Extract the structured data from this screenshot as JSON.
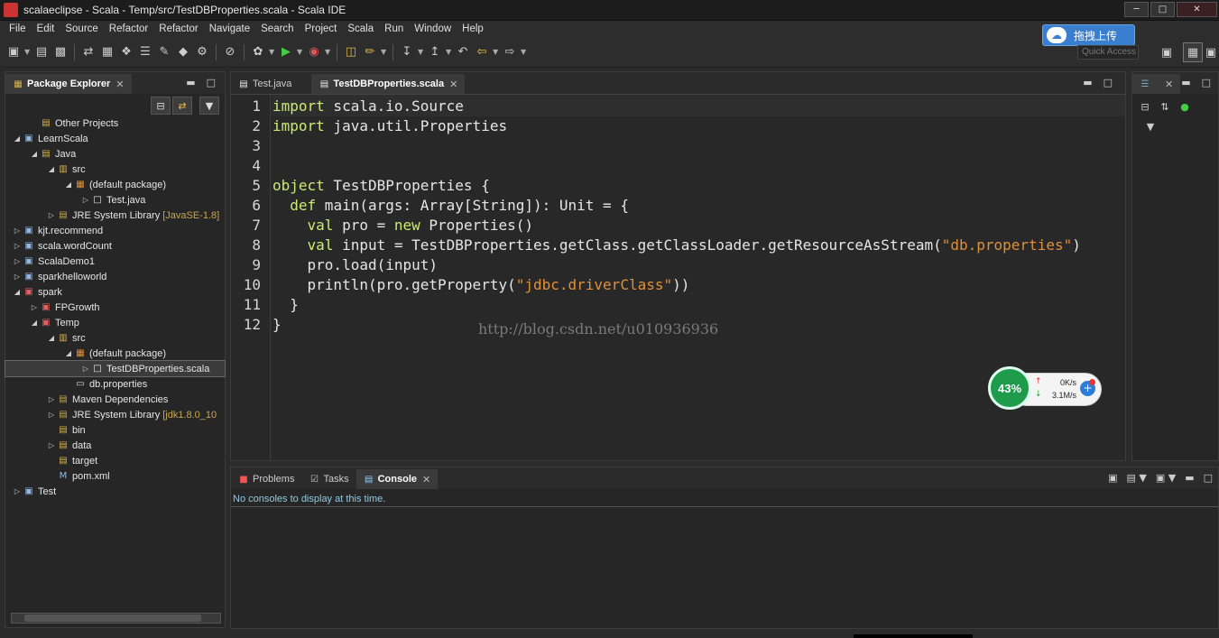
{
  "window": {
    "title": "scalaeclipse - Scala - Temp/src/TestDBProperties.scala - Scala IDE",
    "minimize": "─",
    "maximize": "□",
    "close": "✕"
  },
  "menu": [
    "File",
    "Edit",
    "Source",
    "Refactor",
    "Refactor",
    "Navigate",
    "Search",
    "Project",
    "Scala",
    "Run",
    "Window",
    "Help"
  ],
  "upload_badge": {
    "label": "拖拽上传",
    "icon": "☁"
  },
  "quick_access": {
    "placeholder": "Quick Access"
  },
  "package_explorer": {
    "title": "Package Explorer",
    "tree": [
      {
        "depth": 1,
        "arrow": "",
        "icon": "folder-open",
        "label": "Other Projects",
        "deco": ""
      },
      {
        "depth": 0,
        "arrow": "open",
        "icon": "scala-project",
        "label": "LearnScala",
        "deco": ""
      },
      {
        "depth": 1,
        "arrow": "open",
        "icon": "folder-open",
        "label": "Java",
        "deco": ""
      },
      {
        "depth": 2,
        "arrow": "open",
        "icon": "src-folder",
        "label": "src",
        "deco": ""
      },
      {
        "depth": 3,
        "arrow": "open",
        "icon": "package",
        "label": "(default package)",
        "deco": ""
      },
      {
        "depth": 4,
        "arrow": "closed",
        "icon": "java-file",
        "label": "Test.java",
        "deco": ""
      },
      {
        "depth": 2,
        "arrow": "closed",
        "icon": "library",
        "label": "JRE System Library",
        "deco": "[JavaSE-1.8]"
      },
      {
        "depth": 0,
        "arrow": "closed",
        "icon": "scala-project",
        "label": "kjt.recommend",
        "deco": ""
      },
      {
        "depth": 0,
        "arrow": "closed",
        "icon": "scala-project",
        "label": "scala.wordCount",
        "deco": ""
      },
      {
        "depth": 0,
        "arrow": "closed",
        "icon": "scala-project",
        "label": "ScalaDemo1",
        "deco": ""
      },
      {
        "depth": 0,
        "arrow": "closed",
        "icon": "scala-project",
        "label": "sparkhelloworld",
        "deco": ""
      },
      {
        "depth": 0,
        "arrow": "open",
        "icon": "error-project",
        "label": "spark",
        "deco": ""
      },
      {
        "depth": 1,
        "arrow": "closed",
        "icon": "error-project",
        "label": "FPGrowth",
        "deco": ""
      },
      {
        "depth": 1,
        "arrow": "open",
        "icon": "error-project",
        "label": "Temp",
        "deco": ""
      },
      {
        "depth": 2,
        "arrow": "open",
        "icon": "src-folder",
        "label": "src",
        "deco": ""
      },
      {
        "depth": 3,
        "arrow": "open",
        "icon": "package",
        "label": "(default package)",
        "deco": ""
      },
      {
        "depth": 4,
        "arrow": "closed",
        "icon": "scala-file",
        "label": "TestDBProperties.scala",
        "deco": "",
        "selected": true
      },
      {
        "depth": 3,
        "arrow": "",
        "icon": "file",
        "label": "db.properties",
        "deco": ""
      },
      {
        "depth": 2,
        "arrow": "closed",
        "icon": "library",
        "label": "Maven Dependencies",
        "deco": ""
      },
      {
        "depth": 2,
        "arrow": "closed",
        "icon": "library",
        "label": "JRE System Library",
        "deco": "[jdk1.8.0_10"
      },
      {
        "depth": 2,
        "arrow": "",
        "icon": "folder",
        "label": "bin",
        "deco": ""
      },
      {
        "depth": 2,
        "arrow": "closed",
        "icon": "folder",
        "label": "data",
        "deco": ""
      },
      {
        "depth": 2,
        "arrow": "",
        "icon": "folder",
        "label": "target",
        "deco": ""
      },
      {
        "depth": 2,
        "arrow": "",
        "icon": "maven-file",
        "label": "pom.xml",
        "deco": ""
      },
      {
        "depth": 0,
        "arrow": "closed",
        "icon": "scala-project",
        "label": "Test",
        "deco": ""
      }
    ]
  },
  "editor": {
    "tabs": [
      {
        "label": "Test.java",
        "active": false
      },
      {
        "label": "TestDBProperties.scala",
        "active": true
      }
    ],
    "lines": [
      [
        {
          "t": "import",
          "c": "kw"
        },
        {
          "t": " scala.io.Source",
          "c": ""
        }
      ],
      [
        {
          "t": "import",
          "c": "kw"
        },
        {
          "t": " java.util.Properties",
          "c": ""
        }
      ],
      [],
      [],
      [
        {
          "t": "object",
          "c": "kw"
        },
        {
          "t": " TestDBProperties {",
          "c": ""
        }
      ],
      [
        {
          "t": "  ",
          "c": ""
        },
        {
          "t": "def",
          "c": "kw"
        },
        {
          "t": " main(args: Array[String]): Unit = {",
          "c": ""
        }
      ],
      [
        {
          "t": "    ",
          "c": ""
        },
        {
          "t": "val",
          "c": "kw"
        },
        {
          "t": " pro = ",
          "c": ""
        },
        {
          "t": "new",
          "c": "kw"
        },
        {
          "t": " Properties()",
          "c": ""
        }
      ],
      [
        {
          "t": "    ",
          "c": ""
        },
        {
          "t": "val",
          "c": "kw"
        },
        {
          "t": " input = TestDBProperties.getClass.getClassLoader.getResourceAsStream(",
          "c": ""
        },
        {
          "t": "\"db.properties\"",
          "c": "str"
        },
        {
          "t": ")",
          "c": ""
        }
      ],
      [
        {
          "t": "    pro.load(input)",
          "c": ""
        }
      ],
      [
        {
          "t": "    println(pro.getProperty(",
          "c": ""
        },
        {
          "t": "\"jdbc.driverClass\"",
          "c": "str"
        },
        {
          "t": "))",
          "c": ""
        }
      ],
      [
        {
          "t": "  }",
          "c": ""
        }
      ],
      [
        {
          "t": "}",
          "c": ""
        }
      ]
    ],
    "line_numbers": [
      "1",
      "2",
      "3",
      "4",
      "5",
      "6",
      "7",
      "8",
      "9",
      "10",
      "11",
      "12"
    ],
    "watermark": "http://blog.csdn.net/u010936936"
  },
  "speed_widget": {
    "percent": "43%",
    "upload": "0K/s",
    "download": "3.1M/s"
  },
  "console": {
    "tabs": [
      {
        "label": "Problems",
        "active": false
      },
      {
        "label": "Tasks",
        "active": false
      },
      {
        "label": "Console",
        "active": true
      }
    ],
    "message": "No consoles to display at this time."
  },
  "colors": {
    "keyword": "#cdea73",
    "string": "#e0903a",
    "console_msg": "#8fcbe5"
  }
}
